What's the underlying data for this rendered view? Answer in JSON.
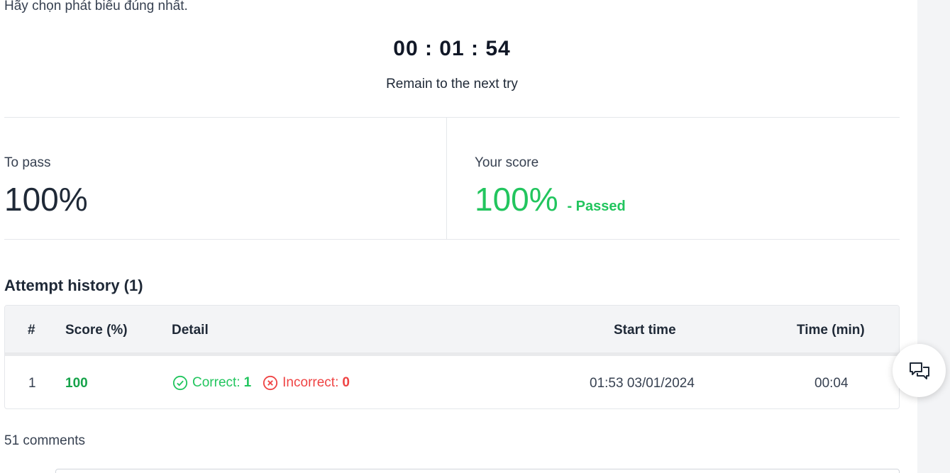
{
  "question": {
    "text": "Hãy chọn phát biểu đúng nhất."
  },
  "timer": {
    "value": "00 : 01 : 54",
    "caption": "Remain to the next try"
  },
  "to_pass": {
    "label": "To pass",
    "value": "100%"
  },
  "your_score": {
    "label": "Your score",
    "value": "100%",
    "status": "- Passed",
    "status_color": "#22c55e"
  },
  "attempt_history": {
    "title": "Attempt history (1)",
    "columns": [
      "#",
      "Score (%)",
      "Detail",
      "Start time",
      "Time (min)"
    ],
    "rows": [
      {
        "index": "1",
        "score": "100",
        "correct_label": "Correct:",
        "correct_value": "1",
        "incorrect_label": "Incorrect:",
        "incorrect_value": "0",
        "start_time": "01:53 03/01/2024",
        "time": "00:04"
      }
    ]
  },
  "comments": {
    "count_label": "51 comments"
  },
  "icons": {
    "correct": "check-circle-icon",
    "incorrect": "x-circle-icon",
    "chat": "chat-bubbles-icon"
  },
  "colors": {
    "success": "#22c55e",
    "danger": "#ef4444",
    "score": "#16a34a"
  }
}
